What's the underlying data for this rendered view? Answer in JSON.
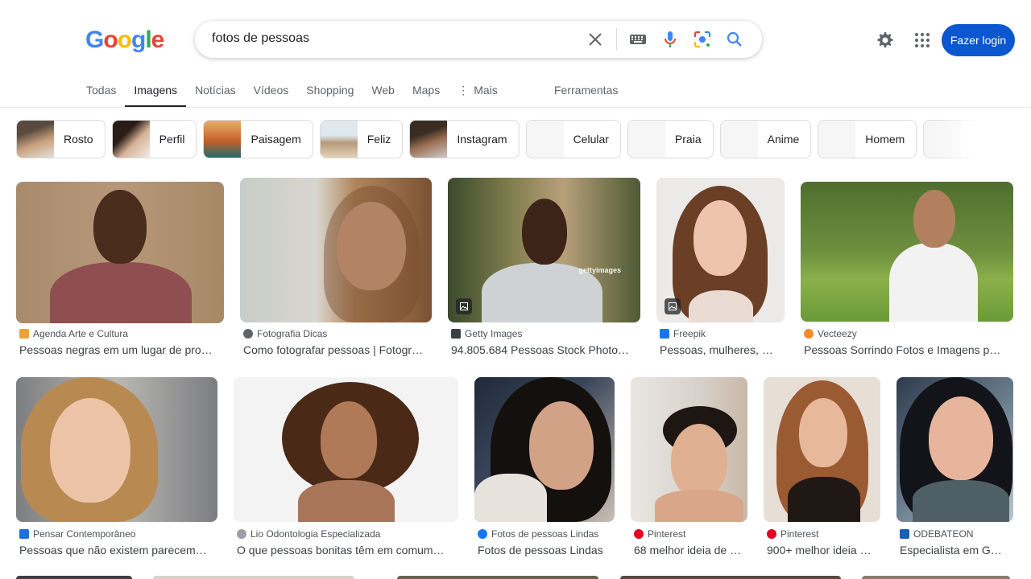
{
  "header": {
    "query": "fotos de pessoas",
    "login_label": "Fazer login",
    "logo_letters": [
      {
        "ch": "G",
        "color": "#4285F4"
      },
      {
        "ch": "o",
        "color": "#EA4335"
      },
      {
        "ch": "o",
        "color": "#FBBC05"
      },
      {
        "ch": "g",
        "color": "#4285F4"
      },
      {
        "ch": "l",
        "color": "#34A853"
      },
      {
        "ch": "e",
        "color": "#EA4335"
      }
    ],
    "icons": [
      "clear-icon",
      "keyboard-icon",
      "microphone-icon",
      "lens-icon",
      "search-icon",
      "gear-icon",
      "apps-icon"
    ]
  },
  "tabs": {
    "items": [
      "Todas",
      "Imagens",
      "Notícias",
      "Vídeos",
      "Shopping",
      "Web",
      "Maps",
      "Mais"
    ],
    "active": "Imagens",
    "tools": "Ferramentas"
  },
  "chips": [
    "Rosto",
    "Perfil",
    "Paisagem",
    "Feliz",
    "Instagram",
    "Celular",
    "Praia",
    "Anime",
    "Homem"
  ],
  "results": [
    {
      "source": "Agenda Arte e Cultura",
      "title": "Pessoas negras em um lugar de pro…",
      "favicon": "#e8a33d"
    },
    {
      "source": "Fotografia Dicas",
      "title": "Como fotografar pessoas | Fotogr…",
      "favicon": "#5f6368"
    },
    {
      "source": "Getty Images",
      "title": "94.805.684 Pessoas Stock Photo…",
      "favicon": "#3c4043",
      "watermark": "gettyimages"
    },
    {
      "source": "Freepik",
      "title": "Pessoas, mulheres, …",
      "favicon": "#1a73e8"
    },
    {
      "source": "Vecteezy",
      "title": "Pessoas Sorrindo Fotos e Imagens p…",
      "favicon": "#f28b28"
    },
    {
      "source": "Pensar Contemporâneo",
      "title": "Pessoas que não existem parecem…",
      "favicon": "#1e6fd9"
    },
    {
      "source": "Lio Odontologia Especializada",
      "title": "O que pessoas bonitas têm em comum…",
      "favicon": "#9aa0a6"
    },
    {
      "source": "Fotos de pessoas Lindas",
      "title": "Fotos de pessoas Lindas",
      "favicon": "#1877f2"
    },
    {
      "source": "Pinterest",
      "title": "68 melhor ideia de …",
      "favicon": "#e60023"
    },
    {
      "source": "Pinterest",
      "title": "900+ melhor ideia …",
      "favicon": "#e60023"
    },
    {
      "source": "ODEBATEON",
      "title": "Especialista em G…",
      "favicon": "#1a5fb4"
    }
  ]
}
